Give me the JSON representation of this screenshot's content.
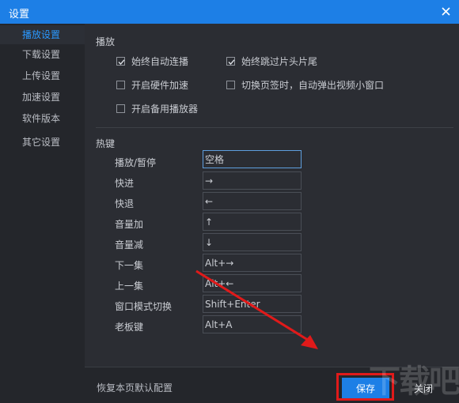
{
  "window": {
    "title": "设置",
    "close_icon": "close-icon"
  },
  "sidebar": {
    "items": [
      {
        "label": "播放设置",
        "active": true
      },
      {
        "label": "下载设置",
        "active": false
      },
      {
        "label": "上传设置",
        "active": false
      },
      {
        "label": "加速设置",
        "active": false
      },
      {
        "label": "软件版本",
        "active": false
      },
      {
        "label": "其它设置",
        "active": false
      }
    ]
  },
  "playback": {
    "title": "播放",
    "options": [
      {
        "label": "始终自动连播",
        "checked": true
      },
      {
        "label": "始终跳过片头片尾",
        "checked": true
      },
      {
        "label": "开启硬件加速",
        "checked": false
      },
      {
        "label": "切换页签时，自动弹出视频小窗口",
        "checked": false
      },
      {
        "label": "开启备用播放器",
        "checked": false
      }
    ]
  },
  "hotkeys": {
    "title": "热键",
    "rows": [
      {
        "label": "播放/暂停",
        "value": "空格"
      },
      {
        "label": "快进",
        "value": "→"
      },
      {
        "label": "快退",
        "value": "←"
      },
      {
        "label": "音量加",
        "value": "↑"
      },
      {
        "label": "音量减",
        "value": "↓"
      },
      {
        "label": "下一集",
        "value": "Alt+→"
      },
      {
        "label": "上一集",
        "value": "Alt+←"
      },
      {
        "label": "窗口模式切换",
        "value": "Shift+Enter"
      },
      {
        "label": "老板键",
        "value": "Alt+A"
      }
    ]
  },
  "footer": {
    "restore_label": "恢复本页默认配置",
    "save_label": "保存",
    "close_label": "关闭"
  },
  "watermark": {
    "text": "下载吧"
  },
  "colors": {
    "accent": "#1d7fe6",
    "background": "#2b2d33",
    "sidebar": "#24262b",
    "annotation": "#e01a1a"
  }
}
